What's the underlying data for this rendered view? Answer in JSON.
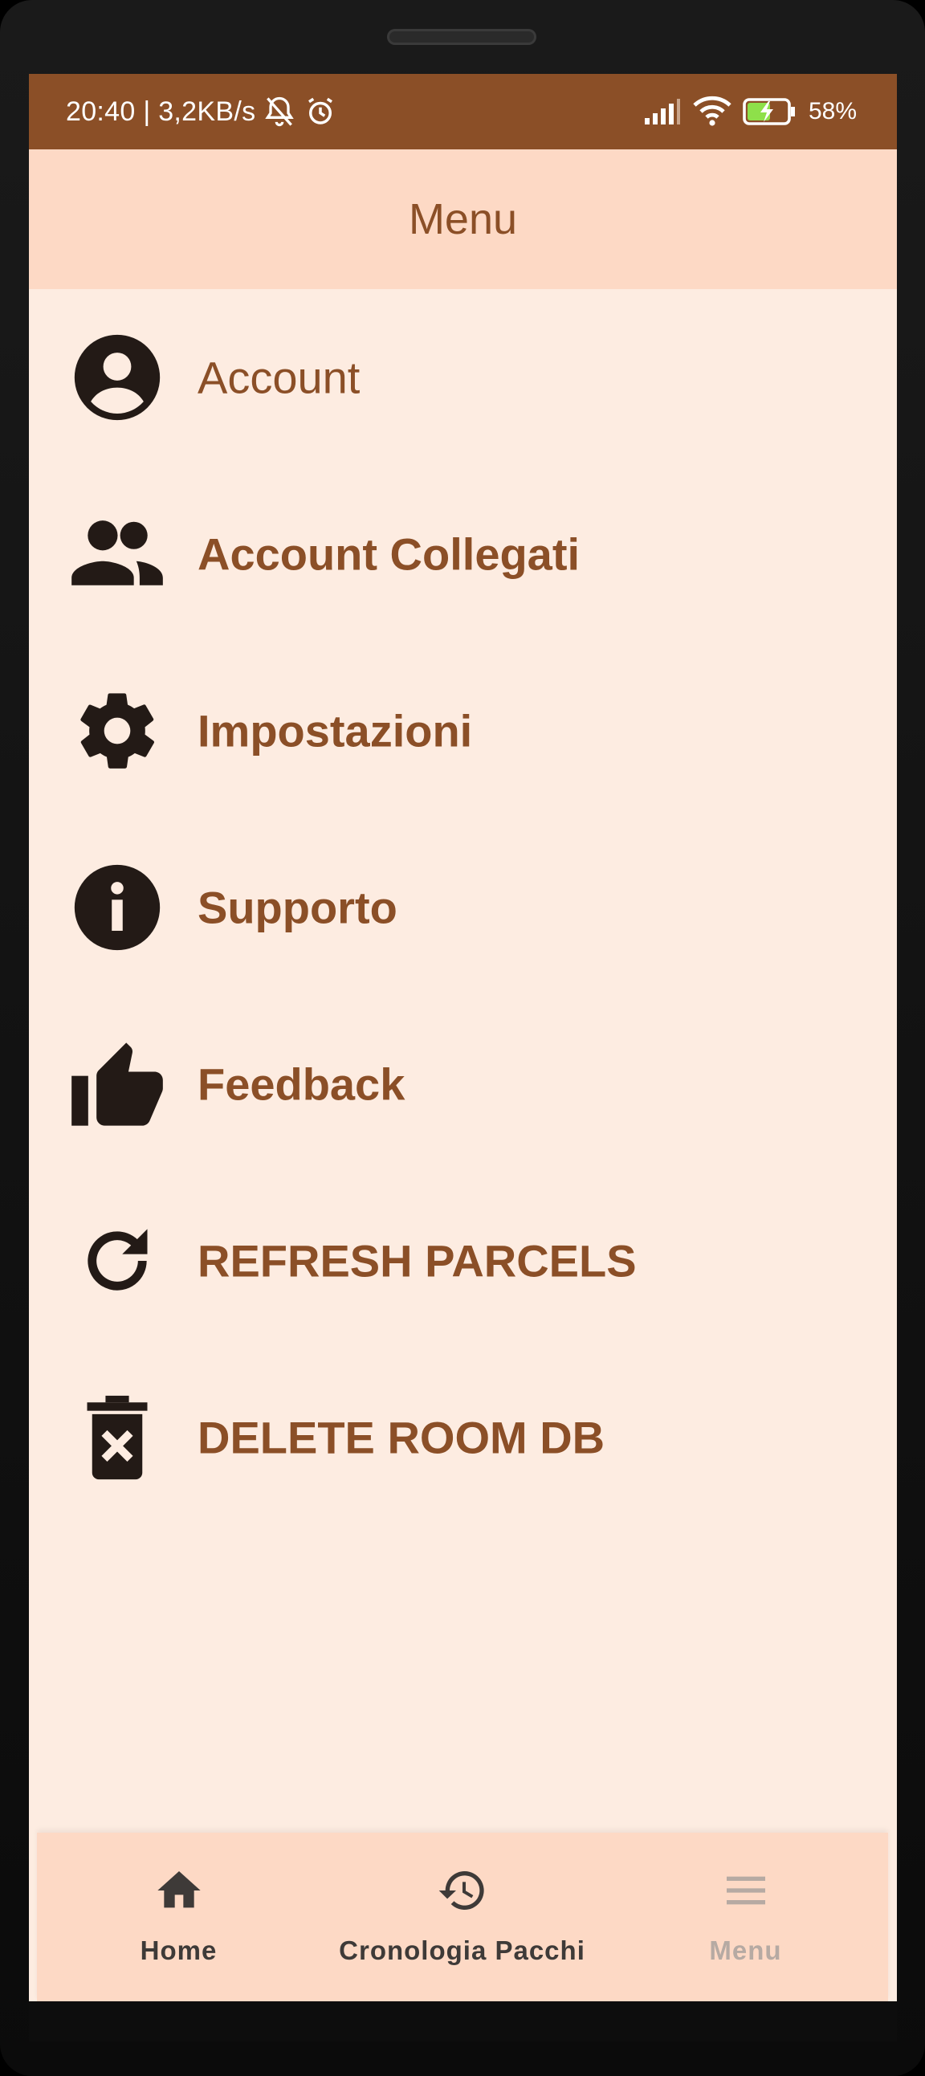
{
  "status_bar": {
    "time_speed": "20:40 | 3,2KB/s",
    "battery": "58%",
    "icons": [
      "mute-icon",
      "alarm-icon",
      "signal-icon",
      "wifi-icon",
      "battery-charging-icon"
    ]
  },
  "header": {
    "title": "Menu"
  },
  "menu": {
    "items": [
      {
        "label": "Account",
        "icon": "account-circle-icon"
      },
      {
        "label": "Account Collegati",
        "icon": "people-icon"
      },
      {
        "label": "Impostazioni",
        "icon": "gear-icon"
      },
      {
        "label": "Supporto",
        "icon": "info-icon"
      },
      {
        "label": "Feedback",
        "icon": "thumb-up-icon"
      },
      {
        "label": "REFRESH PARCELS",
        "icon": "refresh-icon"
      },
      {
        "label": "DELETE ROOM DB",
        "icon": "delete-icon"
      }
    ]
  },
  "bottom_nav": {
    "items": [
      {
        "label": "Home",
        "icon": "home-icon",
        "active": false
      },
      {
        "label": "Cronologia Pacchi",
        "icon": "history-icon",
        "active": false
      },
      {
        "label": "Menu",
        "icon": "menu-icon",
        "active": true
      }
    ]
  },
  "colors": {
    "accent": "#8b4f27",
    "background": "#fdece1",
    "topbar": "#fdd9c5",
    "icon": "#231a16",
    "nav_inactive": "#3e3a38",
    "nav_active": "#b6aaa3"
  }
}
